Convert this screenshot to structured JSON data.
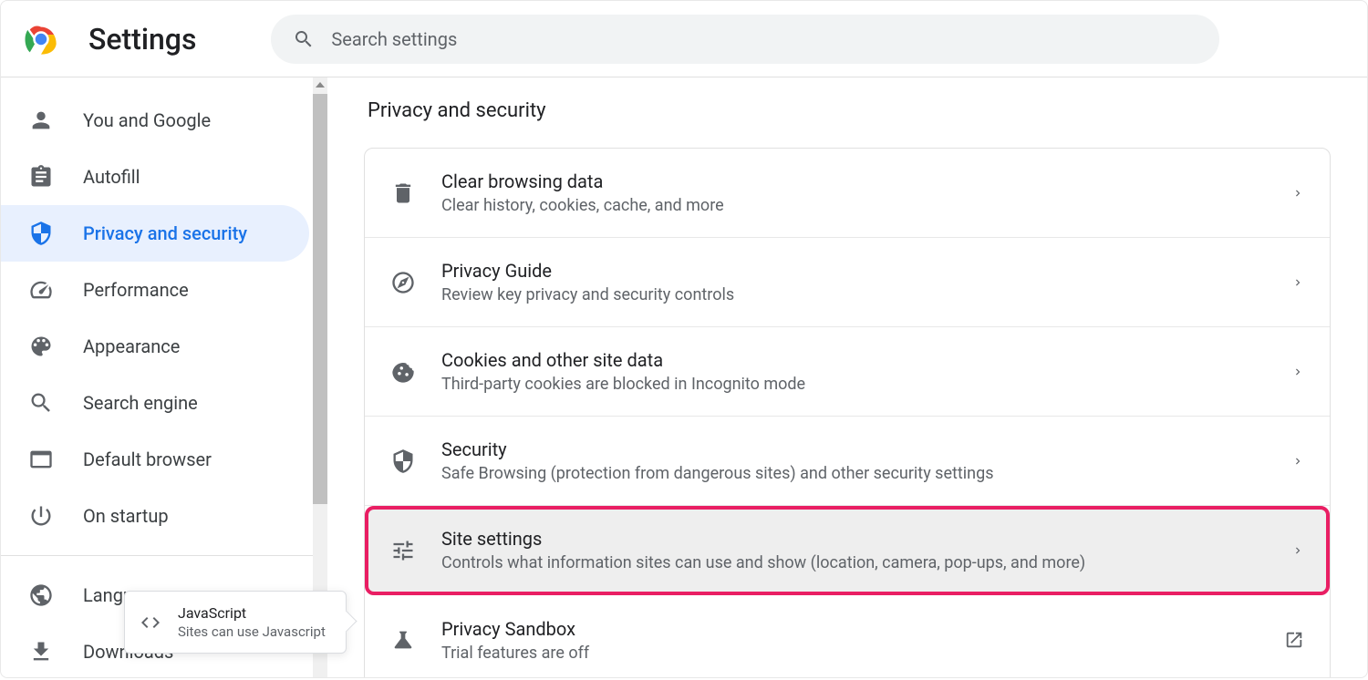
{
  "header": {
    "title": "Settings",
    "search_placeholder": "Search settings"
  },
  "sidebar": {
    "items": [
      {
        "label": "You and Google",
        "icon": "person"
      },
      {
        "label": "Autofill",
        "icon": "assignment"
      },
      {
        "label": "Privacy and security",
        "icon": "shield",
        "active": true
      },
      {
        "label": "Performance",
        "icon": "speedometer"
      },
      {
        "label": "Appearance",
        "icon": "palette"
      },
      {
        "label": "Search engine",
        "icon": "search"
      },
      {
        "label": "Default browser",
        "icon": "browser"
      },
      {
        "label": "On startup",
        "icon": "power"
      }
    ],
    "items2": [
      {
        "label": "Languages",
        "icon": "globe"
      },
      {
        "label": "Downloads",
        "icon": "download"
      }
    ]
  },
  "main": {
    "title": "Privacy and security",
    "rows": [
      {
        "title": "Clear browsing data",
        "subtitle": "Clear history, cookies, cache, and more",
        "icon": "trash",
        "action": "arrow"
      },
      {
        "title": "Privacy Guide",
        "subtitle": "Review key privacy and security controls",
        "icon": "compass",
        "action": "arrow"
      },
      {
        "title": "Cookies and other site data",
        "subtitle": "Third-party cookies are blocked in Incognito mode",
        "icon": "cookie",
        "action": "arrow"
      },
      {
        "title": "Security",
        "subtitle": "Safe Browsing (protection from dangerous sites) and other security settings",
        "icon": "security",
        "action": "arrow"
      },
      {
        "title": "Site settings",
        "subtitle": "Controls what information sites can use and show (location, camera, pop-ups, and more)",
        "icon": "tune",
        "action": "arrow",
        "highlighted": true
      },
      {
        "title": "Privacy Sandbox",
        "subtitle": "Trial features are off",
        "icon": "flask",
        "action": "launch"
      }
    ]
  },
  "tooltip": {
    "title": "JavaScript",
    "subtitle": "Sites can use Javascript"
  }
}
